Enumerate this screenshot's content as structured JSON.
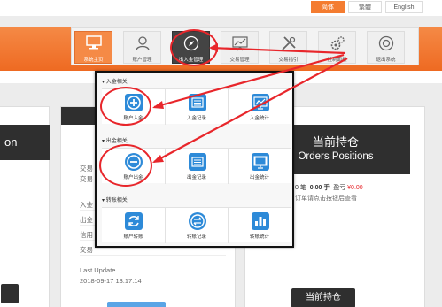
{
  "lang": {
    "active": "简体",
    "traditional": "繁體",
    "english": "English"
  },
  "nav": [
    {
      "label": "系统主页",
      "icon": "monitor-icon"
    },
    {
      "label": "账户管理",
      "icon": "user-icon"
    },
    {
      "label": "出入金管理",
      "icon": "compass-icon"
    },
    {
      "label": "交易管理",
      "icon": "chart-icon"
    },
    {
      "label": "交易指引",
      "icon": "tools-icon"
    },
    {
      "label": "控制面板",
      "icon": "gears-icon"
    },
    {
      "label": "退出系统",
      "icon": "exit-icon"
    }
  ],
  "menu": {
    "sections": [
      {
        "title": "入金相关",
        "items": [
          "账户入金",
          "入金记录",
          "入金统计"
        ]
      },
      {
        "title": "出金相关",
        "items": [
          "账户出金",
          "出金记录",
          "出金统计"
        ]
      },
      {
        "title": "转账相关",
        "items": [
          "账户转账",
          "转账记录",
          "转账统计"
        ]
      }
    ]
  },
  "left_panel": {
    "partial_title": "on"
  },
  "middle_panel": {
    "partial1": "交易",
    "partial2": "交易",
    "rows": [
      "入金",
      "出金",
      "信用",
      "交易"
    ],
    "last_update_label": "Last Update",
    "last_update_value": "2018-09-17 13:17:14"
  },
  "right_panel": {
    "title_cn": "当前持仓",
    "title_en": "Orders Positions",
    "stats_prefix": "0 笔",
    "stats_hand": "0.00 手",
    "stats_profit_label": "盈亏",
    "stats_profit_value": "¥0.00",
    "hint": "订单请点击按钮后查看",
    "button": "当前持仓"
  },
  "colors": {
    "accent": "#ee6a22",
    "menu_blue": "#2d8ad8",
    "highlight_red": "#e8262b"
  }
}
